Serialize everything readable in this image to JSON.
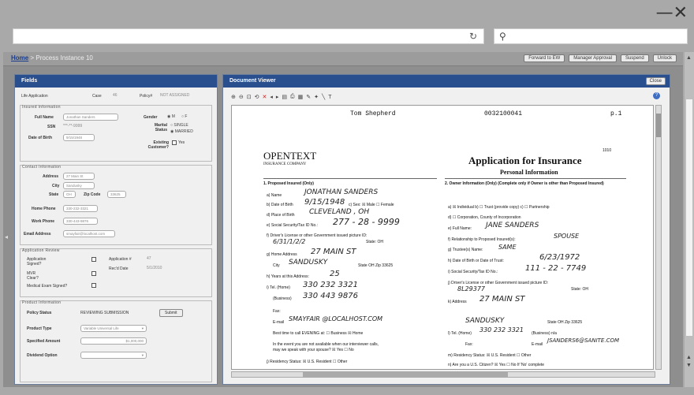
{
  "overlay": {
    "close_glyph": "—✕"
  },
  "search": {
    "placeholder": ""
  },
  "icons": {
    "refresh": "refresh-icon",
    "search": "search-icon"
  },
  "breadcrumb": {
    "home": "Home",
    "separator": " > ",
    "page": "Process Instance 10"
  },
  "top_buttons": [
    "Forward to EW",
    "Manager Approval",
    "Suspend",
    "Unlock"
  ],
  "fields_panel": {
    "title": "Fields",
    "life_application": "Life Application",
    "case_label": "Case",
    "case_value": "46",
    "policy_label": "Policy#",
    "policy_value": "NOT ASSIGNED",
    "insured": {
      "title": "Insured Information",
      "full_name_label": "Full Name",
      "full_name_value": "Jonathan Sanders",
      "gender_label": "Gender",
      "gender_m": "M",
      "gender_f": "F",
      "ssn_label": "SSN",
      "ssn_value": "***-**-9999",
      "marital_label": "Marital Status",
      "marital_single": "SINGLE",
      "marital_married": "MARRIED",
      "dob_label": "Date of Birth",
      "dob_value": "9/15/1948",
      "existing_label": "Existing Customer?",
      "existing_yes": "Yes"
    },
    "contact": {
      "title": "Contact Information",
      "address_label": "Address",
      "address_value": "27 Main St",
      "city_label": "City",
      "city_value": "Sandusky",
      "state_label": "State",
      "state_value": "OH",
      "zip_label": "Zip Code",
      "zip_value": "33625",
      "home_phone_label": "Home Phone",
      "home_phone_value": "330-232-3321",
      "work_phone_label": "Work Phone",
      "work_phone_value": "330-443-9876",
      "email_label": "Email Address",
      "email_value": "smayfair@localhost.com"
    },
    "review": {
      "title": "Application Review",
      "app_signed_label": "Application Signed?",
      "app_num_label": "Application #",
      "app_num_value": "47",
      "recd_label": "Rec'd Date",
      "recd_value": "5/1/2010",
      "mvr_label": "MVR Clear?",
      "medical_label": "Medical Exam Signed?"
    },
    "product": {
      "title": "Product Information",
      "status_label": "Policy Status",
      "status_value": "REVIEWING SUBMISSION",
      "submit_label": "Submit",
      "type_label": "Product Type",
      "type_value": "Variable Universal Life",
      "amount_label": "Specified Amount",
      "amount_value": "$1,000,000",
      "dividend_label": "Dividend Option",
      "dividend_value": ""
    }
  },
  "viewer": {
    "title": "Document Viewer",
    "close_label": "Close",
    "help_glyph": "?",
    "document": {
      "header_name": "Tom  Shepherd",
      "header_number": "0032100041",
      "header_page": "p.1",
      "logo_name": "OPENTEXT",
      "logo_sub": "INSURANCE COMPANY",
      "form_number": "1010",
      "app_title": "Application for Insurance",
      "app_subtitle": "Personal Information",
      "sec1_title": "1.  Proposed Insured (Only)",
      "sec2_title": "2.  Owner Information (Only) (Complete only if Owner is other than Proposed Insured)",
      "name_label": "a)  Name",
      "name_hand": "JONATHAN  SANDERS",
      "dob_label": "b)  Date of Birth",
      "dob_hand": "9/15/1948",
      "sex_label": "c)  Sex:  ☒ Male  ☐ Female",
      "pob_label": "d)  Place of Birth",
      "pob_hand": "CLEVELAND , OH",
      "ssn_label": "e)  Social Security/Tax ID No.:",
      "ssn_hand": "277 - 28 - 9999",
      "dl_label": "f)  Driver's License or other Government issued picture ID:",
      "dl_hand": "6/31/1/2/2",
      "dl_state": "State: OH",
      "addr_label": "g)  Home Address",
      "addr_hand": "27  MAIN  ST",
      "city_label": "City",
      "city_hand": "SANDUSKY",
      "state_zip": "State OH  Zip  33625",
      "years_label": "h)  Years at this Address:",
      "years_hand": "25",
      "tel_label": "i)  Tel. (Home)",
      "tel_hand": "330  232  3321",
      "bus_label": "(Business)",
      "bus_hand": "330  443  9876",
      "fax_label": "Fax:",
      "email_label": "E-mail",
      "email_hand": "SMAYFAIR @LOCALHOST.COM",
      "best_time": "Best time to call  EVENING   at:  ☐ Business  ☒ Home",
      "unavailable": "In the event you are not available when our interviewer calls,",
      "unavailable2": "may we speak with your spouse?  ☒ Yes  ☐ No",
      "residency": "j)  Residency Status: ☒ U.S. Resident  ☐ Other",
      "o_individual": "a) ☒ Individual   b) ☐ Trust (provide copy)   c) ☐ Partnership",
      "o_corp": "d) ☐ Corporation, County of Incorporation",
      "o_fullname_label": "e)  Full Name:",
      "o_fullname_hand": "JANE  SANDERS",
      "o_rel_label": "f)  Relationship to Proposed Insured(s):",
      "o_rel_hand": "SPOUSE",
      "o_trustees": "g)  Trustee(s) Name:",
      "o_trustees_hand": "SAME",
      "o_dob_label": "h)  Date of Birth or Date of Trust:",
      "o_dob_hand": "6/23/1972",
      "o_ssn_label": "i)  Social Security/Tax ID No.:",
      "o_ssn_hand": "111 - 22 - 7749",
      "o_dl_label": "j)  Driver's License or other Government issued picture ID:",
      "o_dl_hand": "8L29377",
      "o_dl_state": "State: OH",
      "o_addr_label": "k)  Address",
      "o_addr_hand": "27  MAIN  ST",
      "o_city_hand": "SANDUSKY",
      "o_state_zip": "State OH  Zip  33625",
      "o_tel_label": "l)  Tel. (Home)",
      "o_tel_hand": "330 232 3321",
      "o_tel_bus": "(Business)  n/a",
      "o_fax": "Fax:",
      "o_email_label": "E-mail",
      "o_email_hand": "JSANDERS6@SANITE.COM",
      "o_residency": "m) Residency Status: ☒ U.S. Resident  ☐ Other",
      "o_citizen": "n) Are you a U.S. Citizen? ☒ Yes  ☐ No  If 'No' complete"
    }
  }
}
